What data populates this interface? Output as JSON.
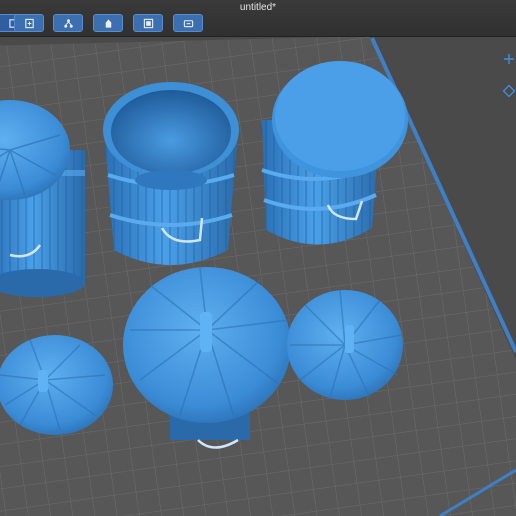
{
  "window": {
    "title": "untitled*"
  },
  "toolbar": {
    "buttons": [
      {
        "icon": "panel-toggle-icon"
      },
      {
        "icon": "open-file-icon"
      },
      {
        "icon": "object-tree-icon"
      },
      {
        "icon": "support-paint-icon"
      },
      {
        "icon": "slice-layer-icon"
      },
      {
        "icon": "print-device-icon"
      }
    ]
  },
  "side_tools": [
    {
      "icon": "add-object-icon"
    },
    {
      "icon": "view-cube-icon"
    }
  ],
  "scene": {
    "plate_color": "#565656",
    "grid_color": "#6b6b6b",
    "boundary_color": "#3f7fc6",
    "model_color": "#3d8fd6",
    "objects": [
      {
        "name": "trash-can-lid-left"
      },
      {
        "name": "trash-can-open"
      },
      {
        "name": "trash-can-closed"
      },
      {
        "name": "lid-small-left"
      },
      {
        "name": "lid-large-center"
      },
      {
        "name": "lid-medium-right"
      }
    ]
  }
}
